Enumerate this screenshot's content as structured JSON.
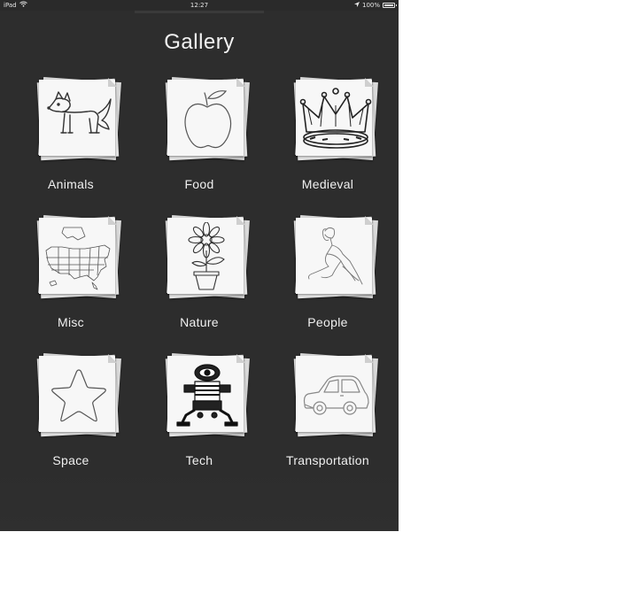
{
  "status_bar": {
    "device": "iPad",
    "time": "12:27",
    "battery": "100%"
  },
  "page": {
    "title": "Gallery"
  },
  "categories": [
    {
      "label": "Animals",
      "icon": "fox-drawing-icon"
    },
    {
      "label": "Food",
      "icon": "apple-drawing-icon"
    },
    {
      "label": "Medieval",
      "icon": "crown-drawing-icon"
    },
    {
      "label": "Misc",
      "icon": "usa-map-drawing-icon"
    },
    {
      "label": "Nature",
      "icon": "sunflower-drawing-icon"
    },
    {
      "label": "People",
      "icon": "woman-drawing-icon"
    },
    {
      "label": "Space",
      "icon": "star-drawing-icon"
    },
    {
      "label": "Tech",
      "icon": "robot-drawing-icon"
    },
    {
      "label": "Transportation",
      "icon": "car-drawing-icon"
    }
  ]
}
